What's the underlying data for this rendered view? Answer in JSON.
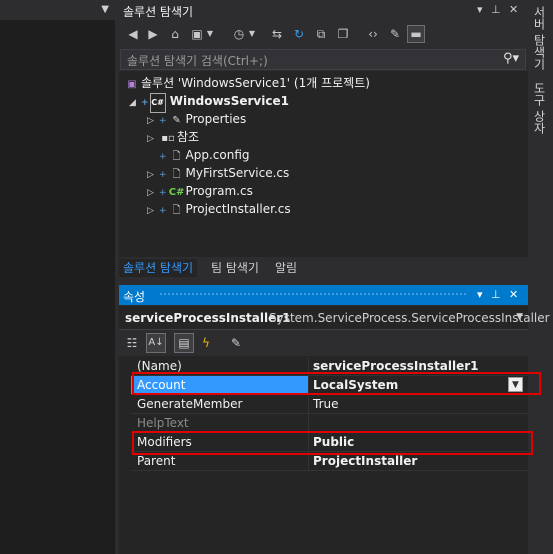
{
  "solution_explorer": {
    "title": "솔루션 탐색기",
    "search_placeholder": "솔루션 탐색기 검색(Ctrl+;)",
    "tree": [
      {
        "label": "솔루션 'WindowsService1' (1개 프로젝트)",
        "icon": "solution-icon"
      },
      {
        "label": "WindowsService1",
        "icon": "csharp-project-icon",
        "bold": true
      },
      {
        "label": "Properties",
        "icon": "wrench-icon"
      },
      {
        "label": "참조",
        "icon": "references-icon"
      },
      {
        "label": "App.config",
        "icon": "config-file-icon"
      },
      {
        "label": "MyFirstService.cs",
        "icon": "cs-file-icon"
      },
      {
        "label": "Program.cs",
        "icon": "csharp-file-icon"
      },
      {
        "label": "ProjectInstaller.cs",
        "icon": "cs-file-icon"
      }
    ],
    "tabs": [
      "솔루션 탐색기",
      "팀 탐색기",
      "알림"
    ]
  },
  "properties": {
    "title": "속성",
    "object_name": "serviceProcessInstaller1",
    "object_type": "System.ServiceProcess.ServiceProcessInstaller",
    "rows": [
      {
        "name": "(Name)",
        "value": "serviceProcessInstaller1"
      },
      {
        "name": "Account",
        "value": "LocalSystem"
      },
      {
        "name": "GenerateMember",
        "value": "True"
      },
      {
        "name": "HelpText",
        "value": ""
      },
      {
        "name": "Modifiers",
        "value": "Public"
      },
      {
        "name": "Parent",
        "value": "ProjectInstaller"
      }
    ]
  },
  "right_strip": {
    "tabs": [
      "서버 탐색기",
      "도구 상자"
    ]
  },
  "colors": {
    "accent": "#007acc",
    "selection": "#3399ff",
    "highlight_box": "#e00000"
  }
}
